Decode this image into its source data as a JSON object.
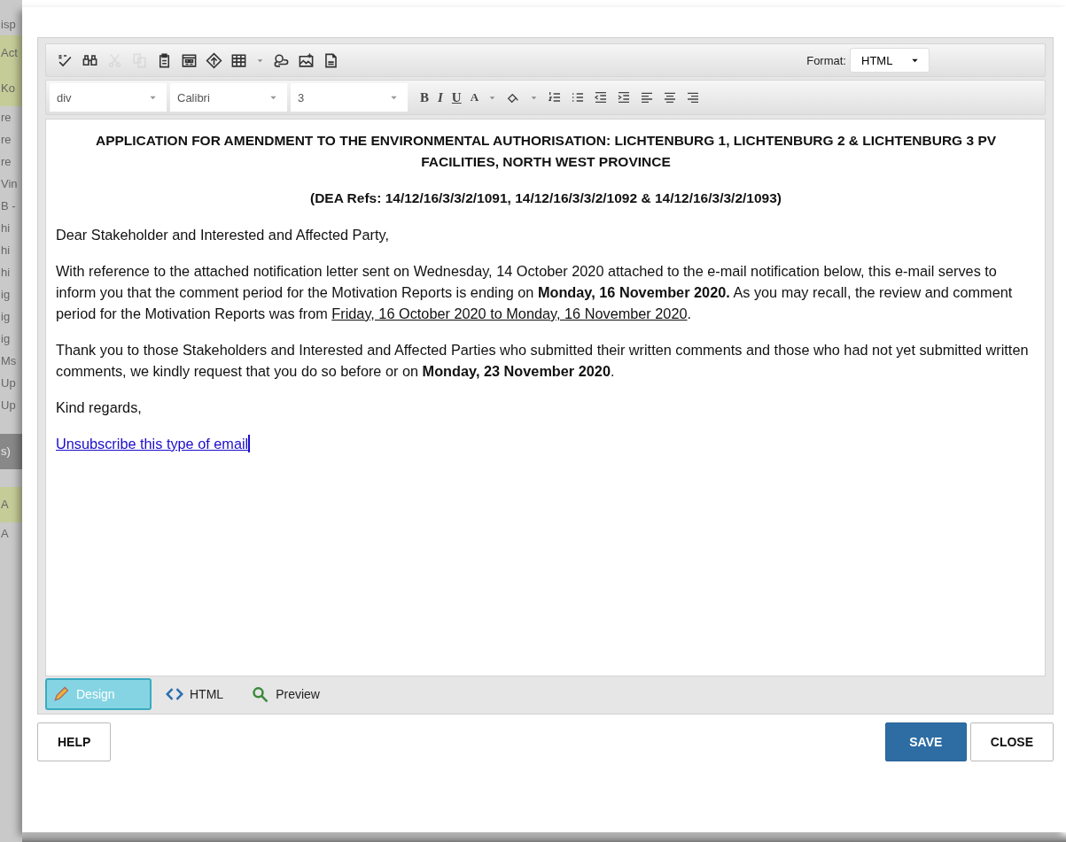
{
  "background_list": [
    {
      "text": "isp",
      "kind": "plain"
    },
    {
      "text": "Act",
      "kind": "highlight"
    },
    {
      "text": "Ko",
      "kind": "highlight"
    },
    {
      "text": "re",
      "kind": "plain"
    },
    {
      "text": "re",
      "kind": "plain"
    },
    {
      "text": "re",
      "kind": "plain"
    },
    {
      "text": "Vin",
      "kind": "plain"
    },
    {
      "text": "B -",
      "kind": "plain"
    },
    {
      "text": "hi",
      "kind": "plain"
    },
    {
      "text": "hi",
      "kind": "plain"
    },
    {
      "text": "hi",
      "kind": "plain"
    },
    {
      "text": "ig",
      "kind": "plain"
    },
    {
      "text": "ig",
      "kind": "plain"
    },
    {
      "text": "ig",
      "kind": "plain"
    },
    {
      "text": "Ms",
      "kind": "plain"
    },
    {
      "text": "Up",
      "kind": "plain"
    },
    {
      "text": "Up",
      "kind": "plain"
    },
    {
      "text": "s)",
      "kind": "dark"
    },
    {
      "text": "A",
      "kind": "highlight"
    },
    {
      "text": "A",
      "kind": "plain"
    }
  ],
  "toolbar": {
    "tools": [
      {
        "kind": "spellcheck",
        "disabled": false
      },
      {
        "kind": "find",
        "disabled": false
      },
      {
        "kind": "cut",
        "disabled": true
      },
      {
        "kind": "copy",
        "disabled": true
      },
      {
        "kind": "paste",
        "disabled": false
      },
      {
        "kind": "template",
        "disabled": false
      },
      {
        "kind": "anchor",
        "disabled": false
      },
      {
        "kind": "table",
        "disabled": false
      },
      {
        "kind": "caret"
      },
      {
        "kind": "link",
        "disabled": false
      },
      {
        "kind": "image",
        "disabled": false
      },
      {
        "kind": "text-doc",
        "disabled": false
      }
    ],
    "format": {
      "label": "Format:",
      "value": "HTML"
    },
    "selects": [
      {
        "value": "div"
      },
      {
        "value": "Calibri"
      },
      {
        "value": "3"
      }
    ],
    "formatting": [
      {
        "kind": "bold",
        "label": "B"
      },
      {
        "kind": "italic",
        "label": "I"
      },
      {
        "kind": "underline",
        "label": "U"
      },
      {
        "kind": "font-color",
        "label": "A"
      },
      {
        "kind": "caret"
      },
      {
        "kind": "highlight"
      },
      {
        "kind": "caret"
      },
      {
        "kind": "ordered-list"
      },
      {
        "kind": "bullet-list"
      },
      {
        "kind": "outdent"
      },
      {
        "kind": "indent"
      },
      {
        "kind": "align-left"
      },
      {
        "kind": "align-center"
      },
      {
        "kind": "align-right"
      }
    ]
  },
  "document": {
    "paragraphs": [
      {
        "kind": "heading",
        "segments": [
          {
            "text": "APPLICATION FOR AMENDMENT TO THE ENVIRONMENTAL AUTHORISATION: LICHTENBURG 1, LICHTENBURG 2 & LICHTENBURG 3 PV FACILITIES, NORTH WEST PROVINCE",
            "kind": "plain"
          }
        ]
      },
      {
        "kind": "heading",
        "segments": [
          {
            "text": "(DEA Refs: 14/12/16/3/3/2/1091, 14/12/16/3/3/2/1092 & 14/12/16/3/3/2/1093)",
            "kind": "plain"
          }
        ]
      },
      {
        "kind": "body",
        "segments": [
          {
            "text": "Dear Stakeholder and Interested and Affected Party,",
            "kind": "plain"
          }
        ]
      },
      {
        "kind": "body",
        "segments": [
          {
            "text": "With reference to the attached notification letter sent on Wednesday, 14 October 2020 attached to the e-mail notification below, this e-mail serves to inform you that the comment period for the Motivation Reports is ending on ",
            "kind": "plain"
          },
          {
            "text": "Monday, 16 November 2020.",
            "kind": "bold"
          },
          {
            "text": "  As you may recall, the review and comment period for the Motivation Reports was from ",
            "kind": "plain"
          },
          {
            "text": "Friday, 16 October 2020 to Monday, 16 November 2020",
            "kind": "underline"
          },
          {
            "text": ".",
            "kind": "plain"
          }
        ]
      },
      {
        "kind": "body",
        "segments": [
          {
            "text": "Thank you to those Stakeholders and Interested and Affected Parties who submitted their written comments and those who had not yet submitted written comments, we kindly request that you do so before or on ",
            "kind": "plain"
          },
          {
            "text": "Monday, 23 November 2020",
            "kind": "bold"
          },
          {
            "text": ".",
            "kind": "plain"
          }
        ]
      },
      {
        "kind": "body",
        "segments": [
          {
            "text": "Kind regards,",
            "kind": "plain"
          }
        ]
      },
      {
        "kind": "link",
        "segments": [
          {
            "text": "Unsubscribe this type of email",
            "kind": "plain"
          }
        ]
      }
    ]
  },
  "mode_tabs": [
    {
      "kind": "design",
      "label": "Design",
      "selected": true
    },
    {
      "kind": "html",
      "label": "HTML",
      "selected": false
    },
    {
      "kind": "preview",
      "label": "Preview",
      "selected": false
    }
  ],
  "buttons": [
    {
      "kind": "secondary",
      "label": "HELP"
    },
    {
      "kind": "primary",
      "label": "SAVE"
    },
    {
      "kind": "secondary",
      "label": "CLOSE"
    }
  ]
}
